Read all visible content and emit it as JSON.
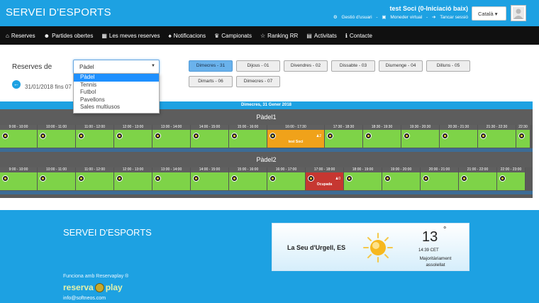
{
  "header": {
    "brand": "SERVEI D'ESPORTS",
    "user_name": "test Soci (0-Iniciació baix)",
    "links": [
      "Gestió d'usuari",
      "Moneder virtual",
      "Tancar sessió"
    ],
    "language": "Català"
  },
  "nav": [
    {
      "label": "Reserves",
      "icon": "home-icon",
      "glyph": "⌂"
    },
    {
      "label": "Partides obertes",
      "icon": "group-icon",
      "glyph": "☻"
    },
    {
      "label": "Les meves reserves",
      "icon": "calendar-icon",
      "glyph": "▦"
    },
    {
      "label": "Notificacions",
      "icon": "bell-icon",
      "glyph": "♠"
    },
    {
      "label": "Campionats",
      "icon": "trophy-icon",
      "glyph": "♛"
    },
    {
      "label": "Ranking RR",
      "icon": "star-icon",
      "glyph": "☆"
    },
    {
      "label": "Activitats",
      "icon": "list-icon",
      "glyph": "▤"
    },
    {
      "label": "Contacte",
      "icon": "info-icon",
      "glyph": "ℹ"
    }
  ],
  "filter": {
    "label": "Reserves de",
    "selected": "Pàdel",
    "options": [
      "Pàdel",
      "Tennis",
      "Futbol",
      "Pavellons",
      "Sales multiusos"
    ],
    "date_range": "31/01/2018 fins 07"
  },
  "days": [
    {
      "label": "Dimecres - 31",
      "active": true
    },
    {
      "label": "Dijous - 01",
      "active": false
    },
    {
      "label": "Divendres - 02",
      "active": false
    },
    {
      "label": "Dissabte - 03",
      "active": false
    },
    {
      "label": "Diumenge - 04",
      "active": false
    },
    {
      "label": "Dilluns - 05",
      "active": false
    },
    {
      "label": "Dimarts - 06",
      "active": false
    },
    {
      "label": "Dimecres - 07",
      "active": false
    }
  ],
  "schedule": {
    "date_title": "Dimecres, 31 Gener 2018",
    "courts": [
      {
        "name": "Pàdel1",
        "slots": [
          "9:00 - 10:00",
          "10:00 - 11:00",
          "11:00 - 12:00",
          "12:00 - 13:00",
          "13:00 - 14:00",
          "14:00 - 15:00",
          "15:00 - 16:00",
          "16:00 - 17:30",
          "17:30 - 18:30",
          "18:30 - 19:30",
          "19:30 - 20:30",
          "20:30 - 21:30",
          "21:30 - 22:30",
          "22:30"
        ],
        "booking": {
          "index": 7,
          "text": "test Soci",
          "count": "2",
          "status": "taken"
        }
      },
      {
        "name": "Pàdel2",
        "slots": [
          "9:00 - 10:00",
          "10:00 - 11:00",
          "11:00 - 12:00",
          "12:00 - 13:00",
          "13:00 - 14:00",
          "14:00 - 15:00",
          "15:00 - 16:00",
          "16:00 - 17:00",
          "17:00 - 18:00",
          "18:00 - 19:00",
          "19:00 - 20:00",
          "20:00 - 21:00",
          "21:00 - 22:00",
          "22:00 - 23:00"
        ],
        "booking": {
          "index": 8,
          "text": "Ocupada",
          "count": "0",
          "status": "busy"
        }
      }
    ]
  },
  "footer": {
    "title": "SERVEI D'ESPORTS",
    "powered": "Funciona amb Reservaplay ®",
    "logo_left": "reserva",
    "logo_right": "play",
    "email": "info@softneos.com"
  },
  "weather": {
    "city": "La Seu d'Urgell, ES",
    "temp": "13",
    "degree": "°",
    "time": "14:39 CET",
    "desc_line1": "Majoritàriament",
    "desc_line2": "assolellat"
  },
  "colors": {
    "brand_blue": "#1da1e2",
    "nav_bg": "#101010",
    "free_slot": "#7ed348",
    "own_booking": "#f0a21a",
    "occupied": "#c63731"
  }
}
